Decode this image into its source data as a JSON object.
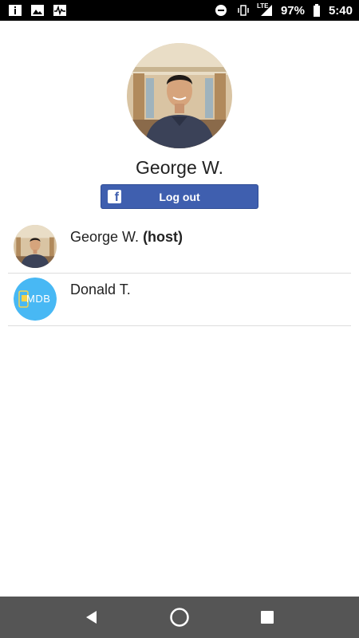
{
  "status_bar": {
    "battery": "97%",
    "time": "5:40",
    "network": "LTE",
    "icons": [
      "info-icon",
      "image-icon",
      "activity-icon",
      "dnd-icon",
      "vibrate-icon",
      "signal-icon",
      "battery-icon"
    ]
  },
  "profile": {
    "name": "George W.",
    "logout_label": "Log out"
  },
  "users": [
    {
      "name": "George W.",
      "tag": "(host)",
      "avatar": "photo"
    },
    {
      "name": "Donald T.",
      "tag": "",
      "avatar": "mdb-logo",
      "avatar_text": "MDB"
    }
  ],
  "nav": {
    "icons": [
      "back-icon",
      "home-icon",
      "recents-icon"
    ]
  },
  "colors": {
    "facebook_blue": "#3f5faf",
    "mdb_blue": "#48b8f4",
    "nav_bar": "#555555"
  }
}
